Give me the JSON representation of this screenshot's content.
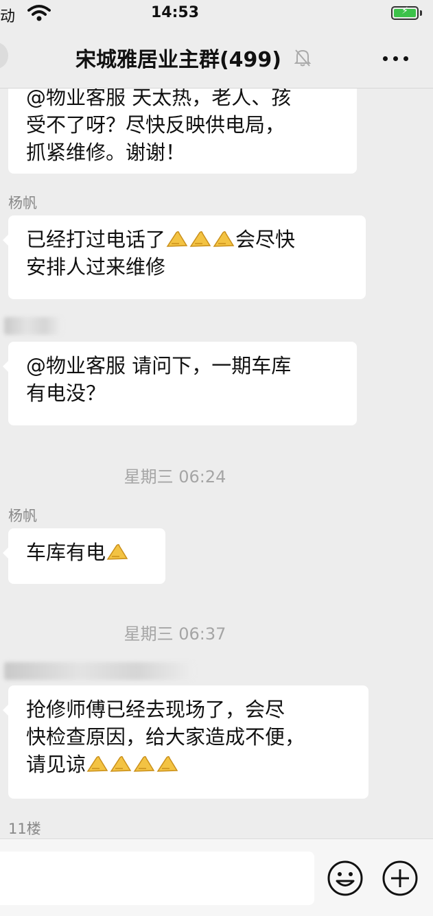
{
  "status_bar": {
    "carrier": "移动",
    "time": "14:53",
    "icons": [
      "wifi-icon",
      "battery-charging-icon"
    ]
  },
  "nav_bar": {
    "title": "宋城雅居业主群",
    "member_count": "(499)",
    "icons": [
      "back-icon",
      "mute-bell-icon",
      "more-icon"
    ]
  },
  "messages": [
    {
      "sender": "",
      "lines": [
        "@物业客服 天太热，老人、孩",
        "受不了呀？尽快反映供电局，",
        "抓紧维修。谢谢！"
      ]
    },
    {
      "sender": "杨帆",
      "lines": [
        "已经打过电话了",
        "安排人过来维修"
      ],
      "line1_emoji_then": "会尽快"
    },
    {
      "sender": "",
      "lines": [
        "@物业客服 请问下，一期车库",
        "有电没？"
      ]
    },
    {
      "timestamp": "星期三 06:24"
    },
    {
      "sender": "杨帆",
      "lines": [
        "车库有电"
      ]
    },
    {
      "timestamp": "星期三 06:37"
    },
    {
      "sender": "",
      "lines": [
        "抢修师傅已经去现场了，会尽",
        "快检查原因，给大家造成不便，",
        "请见谅"
      ]
    },
    {
      "sender": "11楼"
    }
  ],
  "input_bar": {
    "placeholder": "",
    "icons": [
      "emoji-icon",
      "plus-icon"
    ]
  },
  "colors": {
    "background": "#ededed",
    "bubble": "#ffffff",
    "battery": "#3cc24a"
  }
}
